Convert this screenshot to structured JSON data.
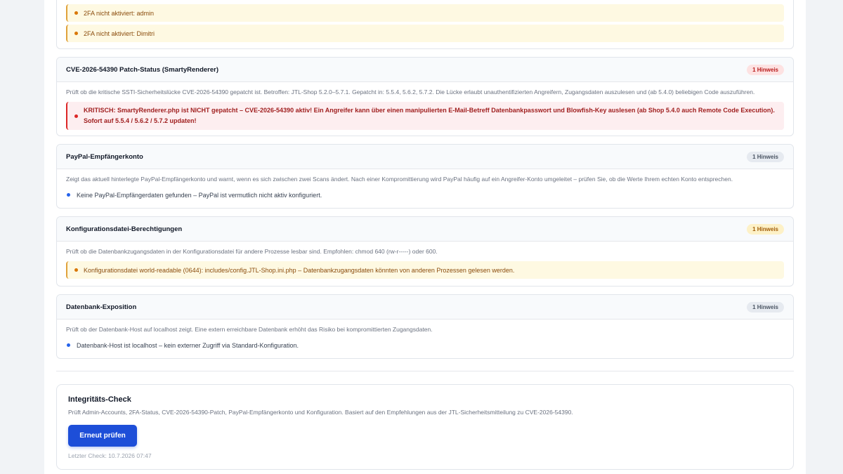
{
  "top_card": {
    "alerts": [
      "2FA nicht aktiviert: admin",
      "2FA nicht aktiviert: Dimitri"
    ]
  },
  "cards": [
    {
      "title": "CVE-2026-54390 Patch-Status (SmartyRenderer)",
      "badge": "1 Hinweis",
      "badge_color": "#b91c1c",
      "description": "Prüft ob die kritische SSTI-Sicherheitslücke CVE-2026-54390 gepatcht ist. Betroffen: JTL-Shop 5.2.0–5.7.1. Gepatcht in: 5.5.4, 5.6.2, 5.7.2. Die Lücke erlaubt unauthentifizierten Angreifern, Zugangsdaten auszulesen und (ab 5.4.0) beliebigen Code auszuführen.",
      "message_line1": "KRITISCH: SmartyRenderer.php ist NICHT gepatcht – CVE-2026-54390 aktiv! Ein Angreifer kann über einen manipulierten E-Mail-Betreff Datenbankpasswort und Blowfish-Key auslesen (ab Shop 5.4.0 auch Remote Code Execution).",
      "message_line2": "Sofort auf 5.5.4 / 5.6.2 / 5.7.2 updaten!"
    },
    {
      "title": "PayPal-Empfängerkonto",
      "badge": "1 Hinweis",
      "description": "Zeigt das aktuell hinterlegte PayPal-Empfängerkonto und warnt, wenn es sich zwischen zwei Scans ändert. Nach einer Kompromittierung wird PayPal häufig auf ein Angreifer-Konto umgeleitet – prüfen Sie, ob die Werte Ihrem echten Konto entsprechen.",
      "message": "Keine PayPal-Empfängerdaten gefunden – PayPal ist vermutlich nicht aktiv konfiguriert."
    },
    {
      "title": "Konfigurationsdatei-Berechtigungen",
      "badge": "1 Hinweis",
      "badge_color": "#a15c07",
      "description": "Prüft ob die Datenbankzugangsdaten in der Konfigurationsdatei für andere Prozesse lesbar sind. Empfohlen: chmod 640 (rw-r-----) oder 600.",
      "message": "Konfigurationsdatei world-readable (0644): includes/config.JTL-Shop.ini.php – Datenbankzugangsdaten könnten von anderen Prozessen gelesen werden."
    },
    {
      "title": "Datenbank-Exposition",
      "badge": "1 Hinweis",
      "description": "Prüft ob der Datenbank-Host auf localhost zeigt. Eine extern erreichbare Datenbank erhöht das Risiko bei kompromittierten Zugangsdaten.",
      "message": "Datenbank-Host ist localhost – kein externer Zugriff via Standard-Konfiguration."
    }
  ],
  "integrity": {
    "title": "Integritäts-Check",
    "description": "Prüft Admin-Accounts, 2FA-Status, CVE-2026-54390-Patch, PayPal-Empfängerkonto und Konfiguration. Basiert auf den Empfehlungen aus der JTL-Sicherheitsmitteilung zu CVE-2026-54390.",
    "button_label": "Erneut prüfen",
    "button_color": "#1d4ed8",
    "last_check": "Letzter Check: 10.7.2026 07:47"
  }
}
